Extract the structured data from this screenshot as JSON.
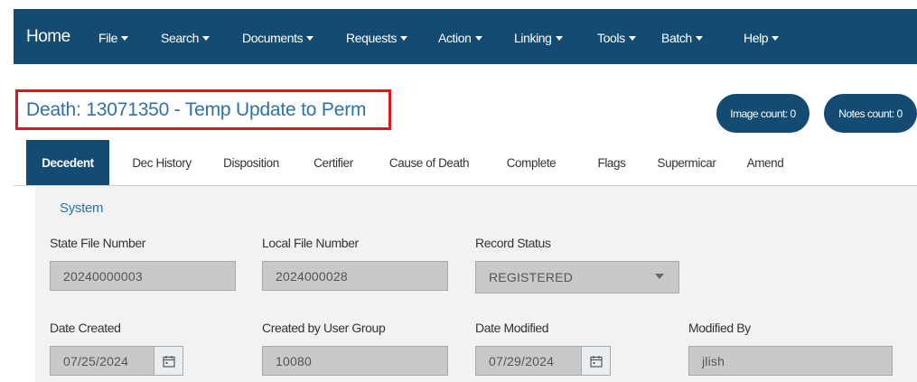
{
  "nav": {
    "home": "Home",
    "menus": [
      "File",
      "Search",
      "Documents",
      "Requests",
      "Action",
      "Linking",
      "Tools",
      "Batch",
      "Help"
    ]
  },
  "header": {
    "title": "Death: 13071350 - Temp Update to Perm",
    "image_count": "Image count: 0",
    "notes_count": "Notes count: 0"
  },
  "tabs": [
    "Decedent",
    "Dec History",
    "Disposition",
    "Certifier",
    "Cause of Death",
    "Complete",
    "Flags",
    "Supermicar",
    "Amend"
  ],
  "active_tab": "Decedent",
  "form": {
    "section": "System",
    "state_file_number": {
      "label": "State File Number",
      "value": "20240000003"
    },
    "local_file_number": {
      "label": "Local File Number",
      "value": "2024000028"
    },
    "record_status": {
      "label": "Record Status",
      "value": "REGISTERED"
    },
    "date_created": {
      "label": "Date Created",
      "value": "07/25/2024"
    },
    "created_by_user_group": {
      "label": "Created by User Group",
      "value": "10080"
    },
    "date_modified": {
      "label": "Date Modified",
      "value": "07/29/2024"
    },
    "modified_by": {
      "label": "Modified By",
      "value": "jlish"
    }
  },
  "colors": {
    "navy": "#144b73",
    "accent_blue": "#2d72a8",
    "highlight_red": "#e0141e"
  }
}
